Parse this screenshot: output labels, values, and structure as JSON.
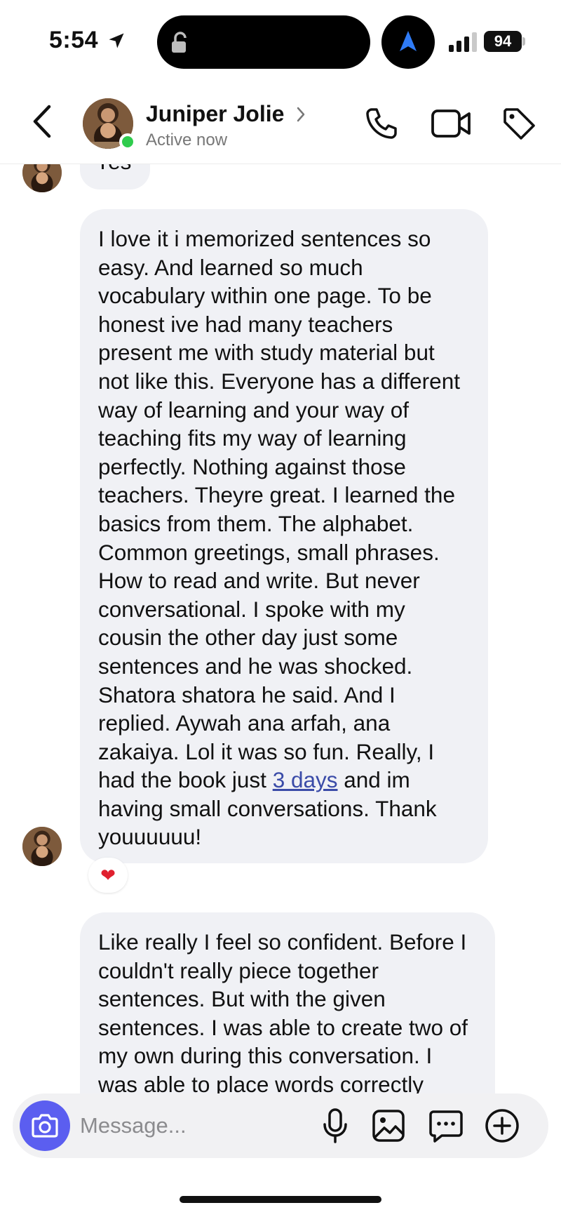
{
  "status_bar": {
    "time": "5:54",
    "battery": "94"
  },
  "header": {
    "contact_name": "Juniper Jolie",
    "status": "Active now"
  },
  "messages": {
    "previous_partial": "Yes",
    "main_before_link": "I love it i memorized sentences so easy. And learned so much vocabulary within one page. To be honest ive had many teachers present me with study material but not like this. Everyone has a different way of learning and your way of teaching fits my way of learning perfectly. Nothing against those teachers. Theyre great. I learned the basics from them. The alphabet. Common greetings, small phrases. How to read and write. But never conversational. I spoke with my cousin the other day just some sentences and he was shocked. Shatora shatora he said. And I replied. Aywah ana arfah, ana zakaiya. Lol it was so fun. Really, I had the book just ",
    "main_link": "3 days",
    "main_after_link": " and im having small conversations. Thank youuuuuu!",
    "main_reaction": "❤",
    "second": "Like really I feel so confident. Before I couldn't really piece together sentences. But with the given sentences. I was able to create two of my own during this conversation. I was able to place words correctly"
  },
  "composer": {
    "placeholder": "Message..."
  },
  "colors": {
    "accent": "#5b5ef0",
    "online": "#2fcc4d",
    "bubble": "#f0f1f5",
    "link": "#3a4ba8"
  },
  "icons": [
    "location-arrow-icon",
    "lock-icon",
    "navigation-icon",
    "signal-icon",
    "battery-icon",
    "back-icon",
    "chevron-right-icon",
    "phone-icon",
    "video-icon",
    "tag-icon",
    "camera-icon",
    "microphone-icon",
    "gallery-icon",
    "sticker-icon",
    "plus-icon",
    "heart-icon"
  ]
}
